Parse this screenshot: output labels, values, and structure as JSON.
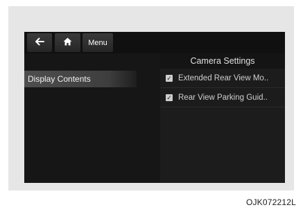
{
  "topbar": {
    "back_icon": "arrow-left-icon",
    "home_icon": "home-icon",
    "menu_label": "Menu"
  },
  "page": {
    "title": "Camera Settings"
  },
  "sidebar": {
    "items": [
      {
        "label": "Display Contents",
        "selected": true
      }
    ]
  },
  "options": [
    {
      "label": "Extended Rear View Mo..",
      "checked": true,
      "icon": "checkbox-checked-icon"
    },
    {
      "label": "Rear View Parking Guid..",
      "checked": true,
      "icon": "checkbox-checked-icon"
    }
  ],
  "figure_code": "OJK072212L"
}
